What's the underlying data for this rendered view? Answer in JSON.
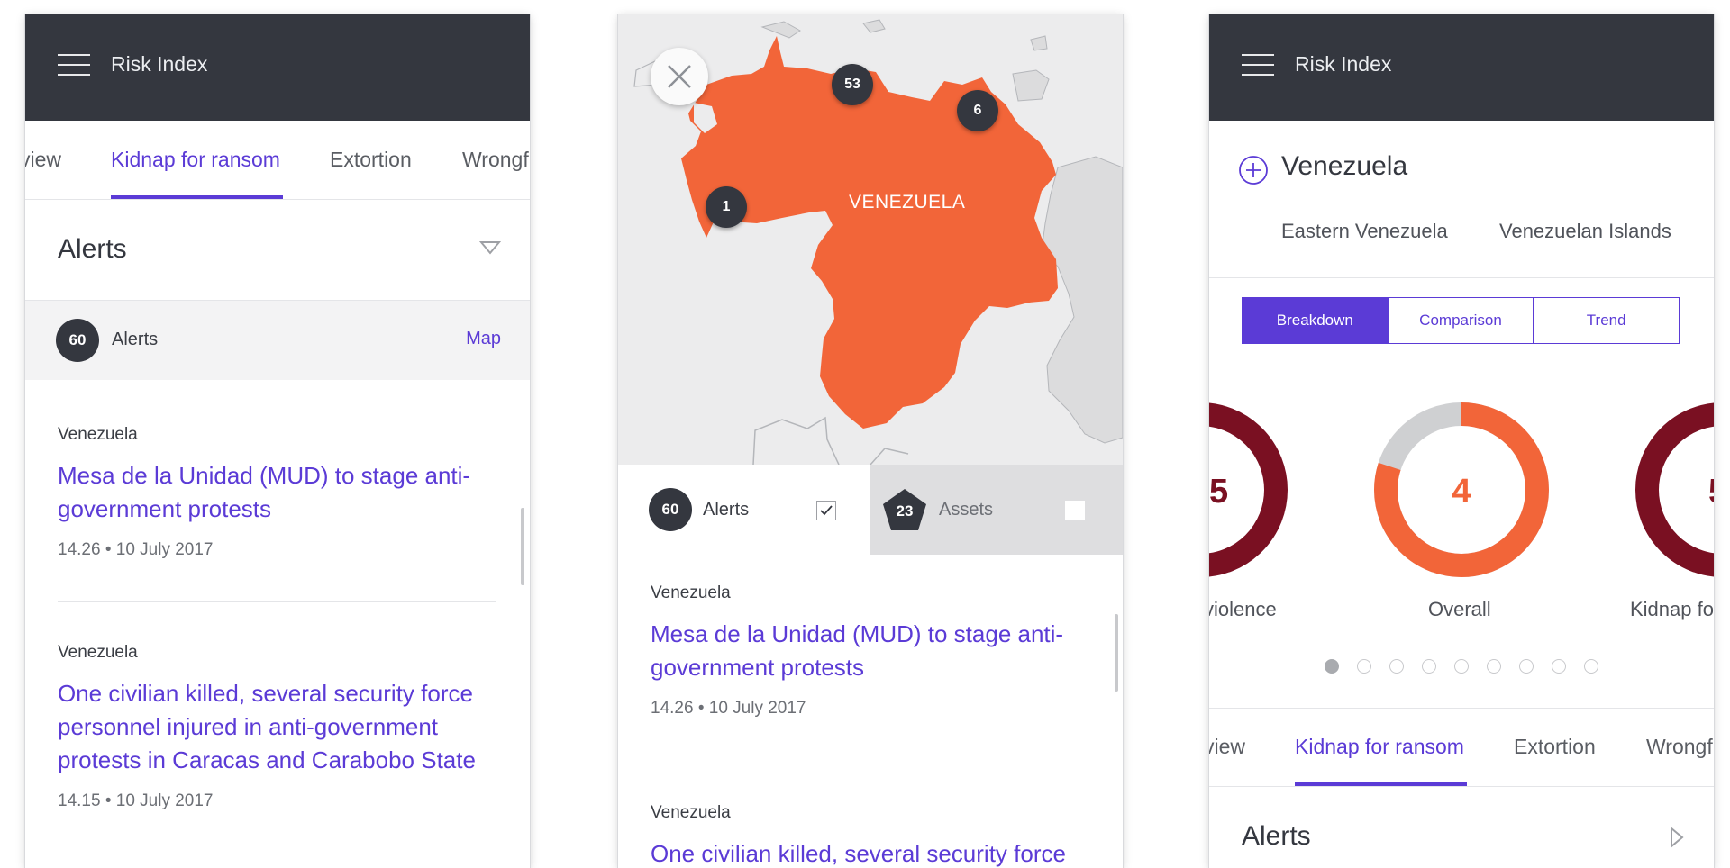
{
  "colors": {
    "appbar": "#34373f",
    "accent": "#5b3bd6",
    "map_country": "#f26539",
    "donut_dark": "#7a1022",
    "donut_grey": "#cfd0d2"
  },
  "panel1": {
    "appbar_title": "Risk Index",
    "tabs": [
      "view",
      "Kidnap for ransom",
      "Extortion",
      "Wrongf"
    ],
    "section_title": "Alerts",
    "alert_count": "60",
    "alert_label": "Alerts",
    "map_link": "Map",
    "items": [
      {
        "location": "Venezuela",
        "title": "Mesa de la Unidad (MUD) to stage anti-government protests",
        "meta": "14.26 • 10 July 2017"
      },
      {
        "location": "Venezuela",
        "title": "One civilian killed, several security force personnel injured in anti-government protests in Caracas and Carabobo State",
        "meta": "14.15 • 10 July 2017"
      }
    ]
  },
  "panel2": {
    "map_country_label": "VENEZUELA",
    "pins": [
      "53",
      "6",
      "1"
    ],
    "alerts_count": "60",
    "alerts_label": "Alerts",
    "assets_count": "23",
    "assets_label": "Assets",
    "items": [
      {
        "location": "Venezuela",
        "title": "Mesa de la Unidad (MUD) to stage anti-government protests",
        "meta": "14.26 • 10 July 2017"
      },
      {
        "location": "Venezuela",
        "title": "One civilian killed, several security force"
      }
    ]
  },
  "panel3": {
    "appbar_title": "Risk Index",
    "country": "Venezuela",
    "subregions": [
      "Eastern Venezuela",
      "Venezuelan Islands"
    ],
    "segments": [
      "Breakdown",
      "Comparison",
      "Trend"
    ],
    "donuts": [
      {
        "label": "violence",
        "value": "5",
        "fraction": 1.0
      },
      {
        "label": "Overall",
        "value": "4",
        "fraction": 0.8
      },
      {
        "label": "Kidnap fo",
        "value": "5",
        "fraction": 1.0
      }
    ],
    "page_count": 9,
    "active_page": 1,
    "tabs": [
      "view",
      "Kidnap for ransom",
      "Extortion",
      "Wrongf"
    ],
    "section_title": "Alerts"
  }
}
